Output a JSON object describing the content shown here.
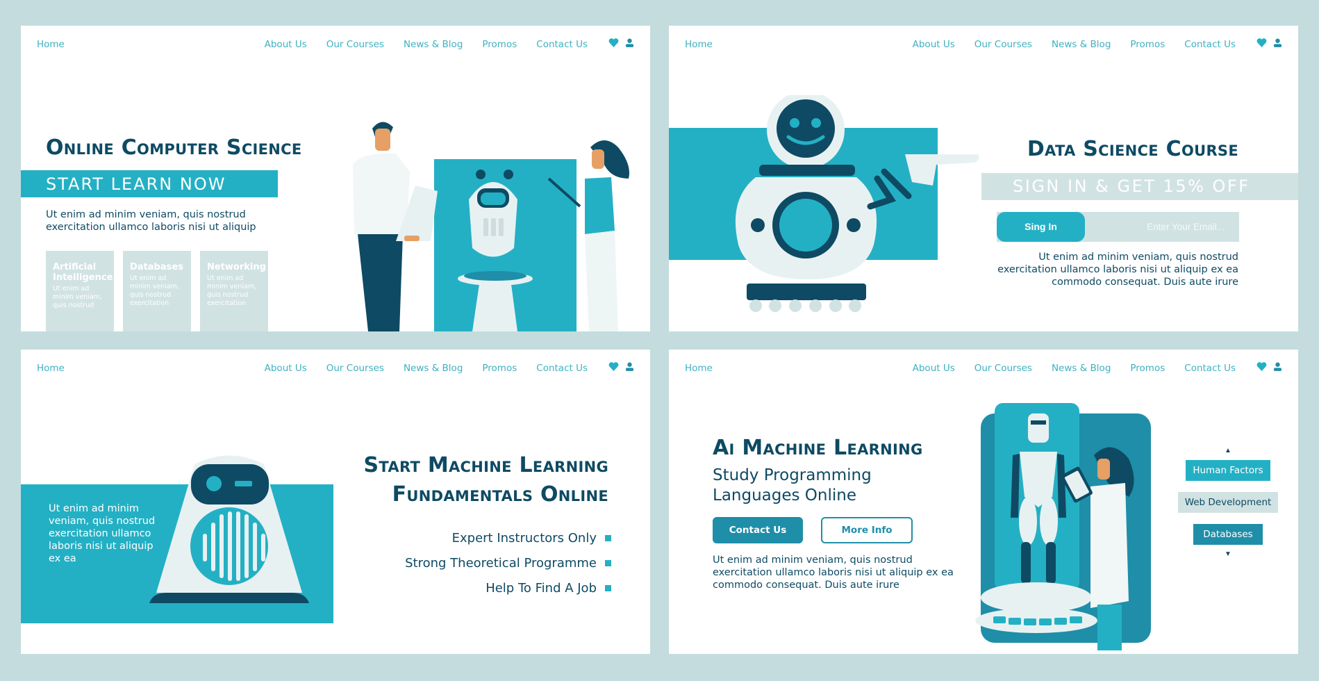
{
  "colors": {
    "background": "#c4dcdd",
    "accent_teal": "#24b0c4",
    "dark_teal": "#1f8ea8",
    "navy": "#0e4a63",
    "light_grey": "#d1e2e2",
    "nav_text": "#3fb1c0"
  },
  "nav": {
    "home": "Home",
    "links": [
      "About Us",
      "Our Courses",
      "News & Blog",
      "Promos",
      "Contact Us"
    ],
    "icons": [
      "heart-icon",
      "user-icon"
    ]
  },
  "panels": [
    {
      "title": "Online Computer Science",
      "banner": "START LEARN NOW",
      "body": "Ut enim ad minim veniam, quis nostrud exercitation ullamco laboris nisi ut aliquip",
      "cards": [
        {
          "title": "Artificial Intelligence",
          "text": "Ut enim ad minim veniam, quis nostrud"
        },
        {
          "title": "Databases",
          "text": "Ut enim ad minim veniam, quis nostrud exercitation"
        },
        {
          "title": "Networking",
          "text": "Ut enim ad minim veniam, quis nostrud exercitation"
        }
      ]
    },
    {
      "title": "Data Science Course",
      "banner": "SIGN IN & GET 15% OFF",
      "signin_label": "Sing In",
      "email_placeholder": "Enter Your Email...",
      "email_value": "",
      "body": "Ut enim ad minim veniam, quis nostrud exercitation ullamco laboris nisi ut aliquip ex ea commodo consequat. Duis aute irure"
    },
    {
      "title_line1": "Start Machine Learning",
      "title_line2": "Fundamentals Online",
      "teal_text": "Ut enim ad minim veniam, quis nostrud exercitation ullamco laboris nisi ut aliquip ex ea",
      "features": [
        "Expert Instructors Only",
        "Strong Theoretical Programme",
        "Help To Find A Job"
      ]
    },
    {
      "title": "Ai Machine Learning",
      "subtitle": "Study Programming Languages Online",
      "contact_label": "Contact Us",
      "more_label": "More Info",
      "body": "Ut enim ad minim veniam, quis nostrud exercitation ullamco laboris nisi ut aliquip ex ea commodo consequat. Duis aute irure",
      "tags": [
        "Human Factors",
        "Web Development",
        "Databases"
      ],
      "arrow_up": "▲",
      "arrow_down": "▼"
    }
  ]
}
